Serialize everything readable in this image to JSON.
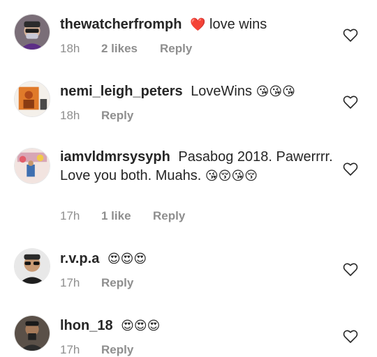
{
  "comments": [
    {
      "username": "thewatcherfromph",
      "text_before": "",
      "emoji_before": "❤️",
      "text": "love wins",
      "emoji_after": "",
      "time": "18h",
      "likes": "2 likes",
      "reply": "Reply",
      "avatar_icon": "avatar-person-mask"
    },
    {
      "username": "nemi_leigh_peters",
      "text": "LoveWins",
      "emoji_after": "😘😘😘",
      "time": "18h",
      "likes": "",
      "reply": "Reply",
      "avatar_icon": "avatar-orange-photo"
    },
    {
      "username": "iamvldmrsysyph",
      "text": "Pasabog 2018. Pawerrrr. Love you both. Muahs.",
      "emoji_after": "😘😚😘😚",
      "time": "17h",
      "likes": "1 like",
      "reply": "Reply",
      "avatar_icon": "avatar-event-photo"
    },
    {
      "username": "r.v.p.a",
      "text": "",
      "emoji_after": "😍😍😍",
      "time": "17h",
      "likes": "",
      "reply": "Reply",
      "avatar_icon": "avatar-sunglasses"
    },
    {
      "username": "lhon_18",
      "text": "",
      "emoji_after": "😍😍😍",
      "time": "17h",
      "likes": "",
      "reply": "Reply",
      "avatar_icon": "avatar-mirror-selfie"
    }
  ],
  "colors": {
    "text": "#262626",
    "meta": "#8e8e8e",
    "heart_red": "#ed4956"
  },
  "icons": {
    "like": "heart-outline-icon"
  }
}
